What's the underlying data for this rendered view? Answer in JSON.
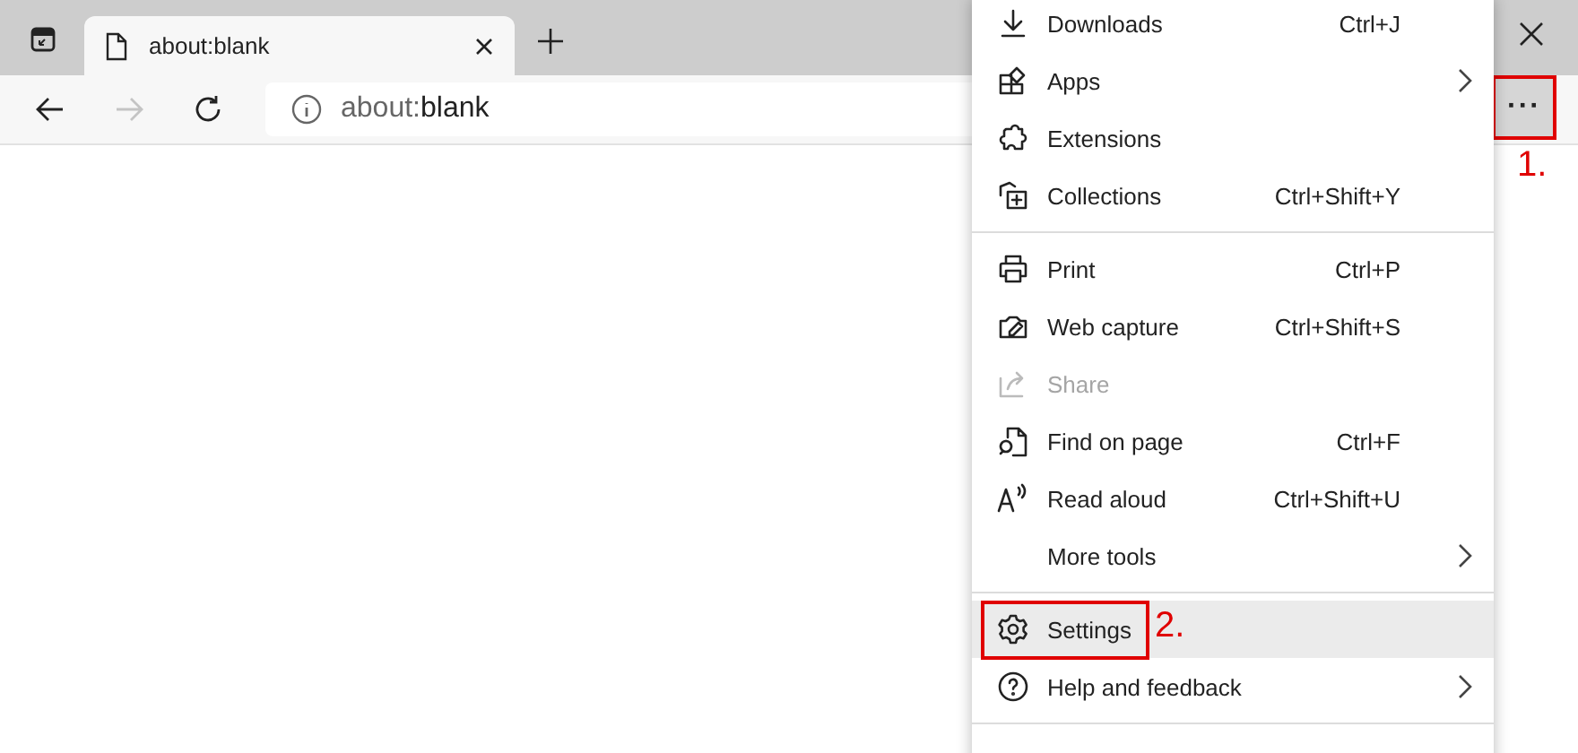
{
  "tabs": [
    {
      "title": "about:blank",
      "selected": true
    }
  ],
  "toolbar": {
    "back_disabled": false,
    "forward_disabled": true,
    "address": {
      "scheme": "about:",
      "rest": "blank"
    },
    "menu_button": {
      "label": "···",
      "callout": "1."
    }
  },
  "menu": {
    "items": [
      {
        "kind": "item",
        "label": "Downloads",
        "shortcut": "Ctrl+J",
        "submenu": false,
        "disabled": false,
        "selected": false
      },
      {
        "kind": "item",
        "label": "Apps",
        "submenu": true,
        "disabled": false,
        "selected": false
      },
      {
        "kind": "item",
        "label": "Extensions",
        "submenu": false,
        "disabled": false,
        "selected": false
      },
      {
        "kind": "item",
        "label": "Collections",
        "shortcut": "Ctrl+Shift+Y",
        "submenu": false,
        "disabled": false,
        "selected": false
      },
      {
        "kind": "divider"
      },
      {
        "kind": "item",
        "label": "Print",
        "shortcut": "Ctrl+P",
        "submenu": false,
        "disabled": false,
        "selected": false
      },
      {
        "kind": "item",
        "label": "Web capture",
        "shortcut": "Ctrl+Shift+S",
        "submenu": false,
        "disabled": false,
        "selected": false
      },
      {
        "kind": "item",
        "label": "Share",
        "submenu": false,
        "disabled": true,
        "selected": false
      },
      {
        "kind": "item",
        "label": "Find on page",
        "shortcut": "Ctrl+F",
        "submenu": false,
        "disabled": false,
        "selected": false
      },
      {
        "kind": "item",
        "label": "Read aloud",
        "shortcut": "Ctrl+Shift+U",
        "submenu": false,
        "disabled": false,
        "selected": false
      },
      {
        "kind": "item",
        "label": "More tools",
        "submenu": true,
        "disabled": false,
        "selected": false
      },
      {
        "kind": "divider"
      },
      {
        "kind": "item",
        "label": "Settings",
        "submenu": false,
        "disabled": false,
        "selected": true,
        "callout": "2."
      },
      {
        "kind": "item",
        "label": "Help and feedback",
        "submenu": true,
        "disabled": false,
        "selected": false
      },
      {
        "kind": "divider"
      }
    ]
  }
}
